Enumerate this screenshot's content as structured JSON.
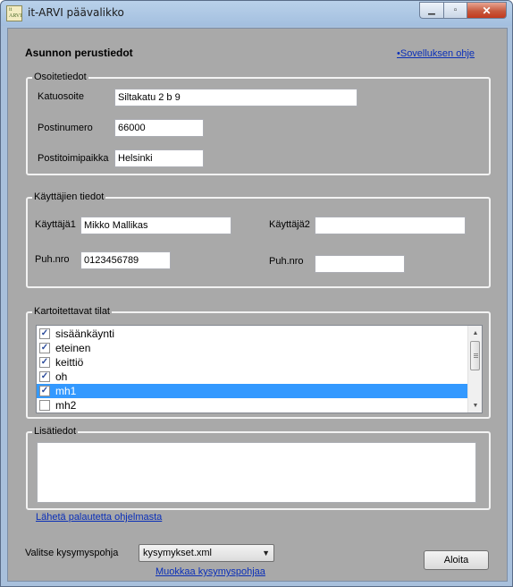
{
  "window": {
    "title": "it-ARVI päävalikko",
    "icon_text": "it ARVI",
    "caption_buttons": {
      "minimize": "▁",
      "maximize": "▫",
      "close": "✕"
    }
  },
  "header": {
    "title": "Asunnon perustiedot",
    "help_link": "•Sovelluksen ohje"
  },
  "address_group": {
    "title": "Osoitetiedot",
    "street_label": "Katuosoite",
    "street_value": "Siltakatu 2 b 9",
    "postal_code_label": "Postinumero",
    "postal_code_value": "66000",
    "city_label": "Postitoimipaikka",
    "city_value": "Helsinki"
  },
  "users_group": {
    "title": "Käyttäjien tiedot",
    "user1_label": "Käyttäjä1",
    "user1_value": "Mikko Mallikas",
    "user2_label": "Käyttäjä2",
    "user2_value": "",
    "phone1_label": "Puh.nro",
    "phone1_value": "0123456789",
    "phone2_label": "Puh.nro",
    "phone2_value": ""
  },
  "rooms_group": {
    "title": "Kartoitettavat tilat",
    "items": [
      {
        "label": "sisäänkäynti",
        "checked": true,
        "selected": false
      },
      {
        "label": "eteinen",
        "checked": true,
        "selected": false
      },
      {
        "label": "keittiö",
        "checked": true,
        "selected": false
      },
      {
        "label": "oh",
        "checked": true,
        "selected": false
      },
      {
        "label": "mh1",
        "checked": true,
        "selected": true
      },
      {
        "label": "mh2",
        "checked": false,
        "selected": false
      }
    ]
  },
  "extra_group": {
    "title": "Lisätiedot",
    "value": ""
  },
  "footer": {
    "feedback_link": "Lähetä palautetta ohjelmasta",
    "template_label": "Valitse kysymyspohja",
    "template_value": "kysymykset.xml",
    "edit_template_link": "Muokkaa kysymyspohjaa",
    "start_button": "Aloita"
  },
  "colors": {
    "client_background": "#a9a9a9",
    "selection": "#3399ff",
    "link": "#0a2fb8"
  }
}
